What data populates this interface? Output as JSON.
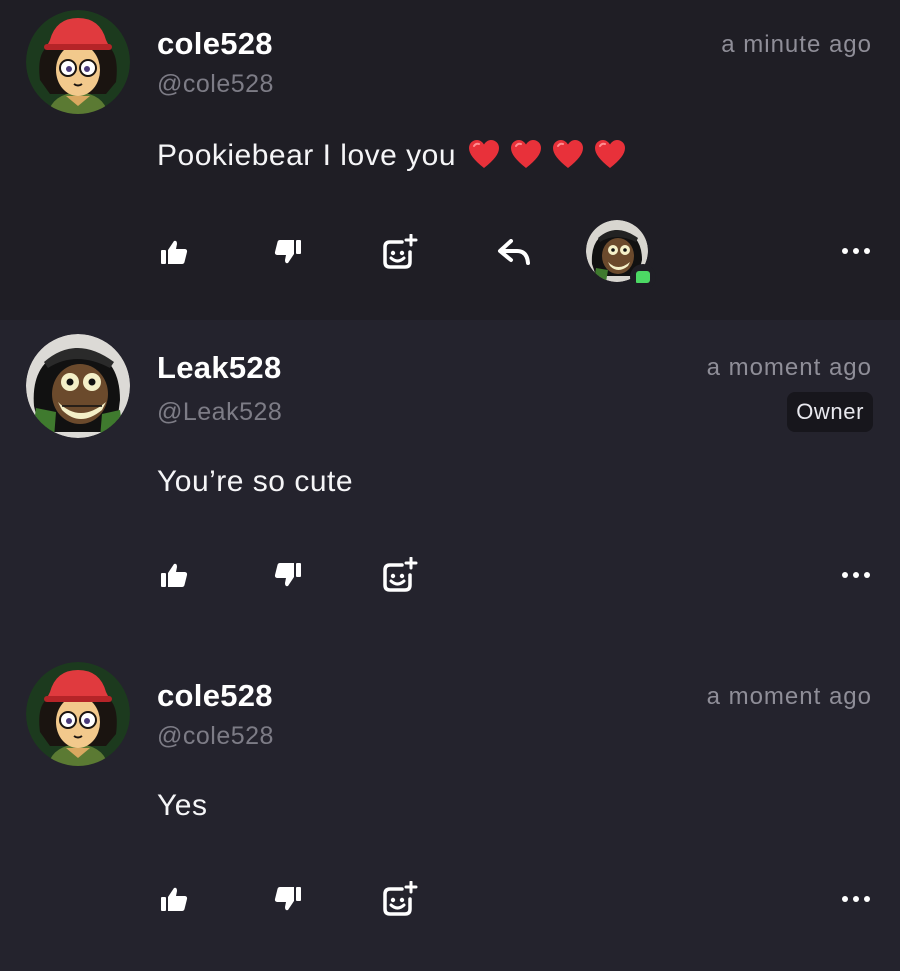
{
  "comments": [
    {
      "username": "cole528",
      "handle": "@cole528",
      "time": "a minute ago",
      "text": "Pookiebear I love you",
      "hearts": 4,
      "avatar": "cole-avatar"
    },
    {
      "username": "Leak528",
      "handle": "@Leak528",
      "time": "a moment ago",
      "badge": "Owner",
      "text": "You’re so cute",
      "avatar": "leak-avatar"
    },
    {
      "username": "cole528",
      "handle": "@cole528",
      "time": "a moment ago",
      "text": "Yes",
      "avatar": "cole-avatar"
    }
  ],
  "icons": {
    "like": "thumbs-up-icon",
    "dislike": "thumbs-down-icon",
    "react": "add-reaction-icon",
    "reply": "reply-icon",
    "more": "more-icon",
    "heart": "red-heart-icon"
  },
  "colors": {
    "background": "#24232d",
    "highlighted_background": "#1f1e25",
    "secondary_text": "#7d7c86",
    "online_indicator": "#4cd964",
    "heart": "#e8313a"
  }
}
